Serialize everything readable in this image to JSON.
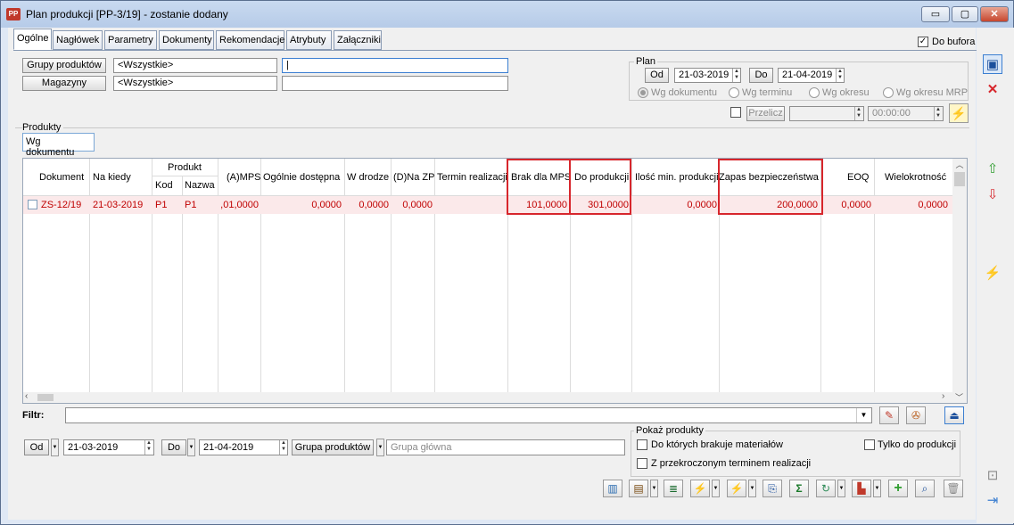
{
  "window": {
    "title": "Plan produkcji [PP-3/19] - zostanie dodany",
    "icon_text": "PP"
  },
  "window_controls": {
    "minimize": "▭",
    "maximize": "▢",
    "close": "✕"
  },
  "tabs": [
    "Ogólne",
    "Nagłówek",
    "Parametry",
    "Dokumenty",
    "Rekomendacje",
    "Atrybuty",
    "Załączniki"
  ],
  "do_bufora": {
    "label": "Do bufora",
    "checked": true
  },
  "filters": {
    "grupy_label": "Grupy produktów",
    "grupy_value": "<Wszystkie>",
    "magazyny_label": "Magazyny",
    "magazyny_value": "<Wszystkie>"
  },
  "plan": {
    "label": "Plan",
    "od_label": "Od",
    "od_value": "21-03-2019",
    "do_label": "Do",
    "do_value": "21-04-2019",
    "radios": [
      "Wg dokumentu",
      "Wg terminu",
      "Wg okresu",
      "Wg okresu MRP"
    ],
    "przelicz_label": "Przelicz",
    "time_value": "00:00:00"
  },
  "produkty": {
    "label": "Produkty",
    "subtab": "Wg dokumentu"
  },
  "grid": {
    "headers": {
      "dokument": "Dokument",
      "na_kiedy": "Na kiedy",
      "produkt": "Produkt",
      "kod": "Kod",
      "nazwa": "Nazwa",
      "a_mps": "(A)MPS",
      "ogolnie": "Ogólnie dostępna",
      "w_drodze": "W drodze",
      "na_zp": "(D)Na ZP",
      "termin": "Termin realizacji",
      "brak": "Brak dla MPS",
      "do_produkcji": "Do produkcji",
      "ilosc_min": "Ilość min. produkcji",
      "zapas": "Zapas bezpieczeństwa",
      "eoq": "EOQ",
      "wielokrotnosc": "Wielokrotność"
    },
    "row": {
      "dokument": "ZS-12/19",
      "na_kiedy": "21-03-2019",
      "kod": "P1",
      "nazwa": "P1",
      "a_mps": ",01,0000",
      "ogolnie": "0,0000",
      "w_drodze": "0,0000",
      "na_zp": "0,0000",
      "termin": "",
      "brak": "101,0000",
      "do_produkcji": "301,0000",
      "ilosc_min": "0,0000",
      "zapas": "200,0000",
      "eoq": "0,0000",
      "wielokrotnosc": "0,0000"
    }
  },
  "filtr": {
    "label": "Filtr:",
    "value": ""
  },
  "bottom": {
    "od_label": "Od",
    "od_value": "21-03-2019",
    "do_label": "Do",
    "do_value": "21-04-2019",
    "grupa_label": "Grupa produktów",
    "grupa_value": "Grupa główna",
    "pokaz_label": "Pokaż produkty",
    "chk1": "Do których brakuje materiałów",
    "chk2": "Tylko do produkcji",
    "chk3": "Z przekroczonym terminem realizacji"
  },
  "colors": {
    "row_text": "#c00000",
    "highlight": "#d7262c",
    "accent": "#3c7fd1"
  }
}
